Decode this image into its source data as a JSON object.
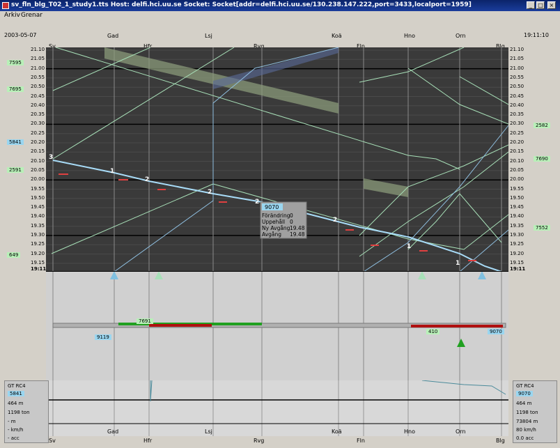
{
  "window": {
    "title": "sv_fln_blg_T02_1_study1.tts  Host: delfi.hci.uu.se Socket: Socket[addr=delfi.hci.uu.se/130.238.147.222,port=3433,localport=1959]",
    "minimize": "_",
    "maximize": "□",
    "close": "×"
  },
  "menu": [
    "Arkiv",
    "Grenar"
  ],
  "header": {
    "date": "2003-05-07",
    "clock": "19:11:10"
  },
  "stations": [
    "Sv",
    "Gad",
    "Hfr",
    "Lsj",
    "Rvg",
    "Koä",
    "Fln",
    "Hno",
    "Orn",
    "Blg"
  ],
  "time_axis": {
    "ticks": [
      "21.10",
      "21.05",
      "21.00",
      "20.55",
      "20.50",
      "20.45",
      "20.40",
      "20.35",
      "20.30",
      "20.25",
      "20.20",
      "20.15",
      "20.10",
      "20.05",
      "20.00",
      "19.55",
      "19.50",
      "19.45",
      "19.40",
      "19.35",
      "19.30",
      "19.25",
      "19.20",
      "19.15"
    ],
    "now": "19:11"
  },
  "left_train_tags": [
    "7595",
    "7695",
    "5841",
    "2591",
    "649"
  ],
  "right_train_tags": [
    "2582",
    "7690",
    "7552"
  ],
  "stop_markers": [
    "3",
    "1",
    "2",
    "2",
    "2",
    "2",
    "1",
    "1"
  ],
  "tooltip": {
    "train": "9070",
    "rows": [
      {
        "k": "Förändring",
        "v": "0"
      },
      {
        "k": "Uppehåll",
        "v": "0"
      },
      {
        "k": "Ny Avgång",
        "v": "19.48"
      },
      {
        "k": "Avgång",
        "v": "19.48"
      }
    ]
  },
  "track_tags": {
    "t1": "7691",
    "t2": "9119",
    "t3": "410",
    "t4": "9070"
  },
  "left_panel": {
    "type": "GT  RC4",
    "train": "5841",
    "length": "464 m",
    "weight": "1198 ton",
    "dist": "- m",
    "speed": "- km/h",
    "acc": "- acc"
  },
  "right_panel": {
    "type": "GT  RC4",
    "train": "9070",
    "length": "464 m",
    "weight": "1198 ton",
    "dist": "73804 m",
    "speed": "80 km/h",
    "acc": "0.0 acc"
  },
  "colors": {
    "train_now": "#9ad6f0",
    "other_trains": "#b8f0b8",
    "occupied": "#b01010",
    "free": "#20a020"
  }
}
